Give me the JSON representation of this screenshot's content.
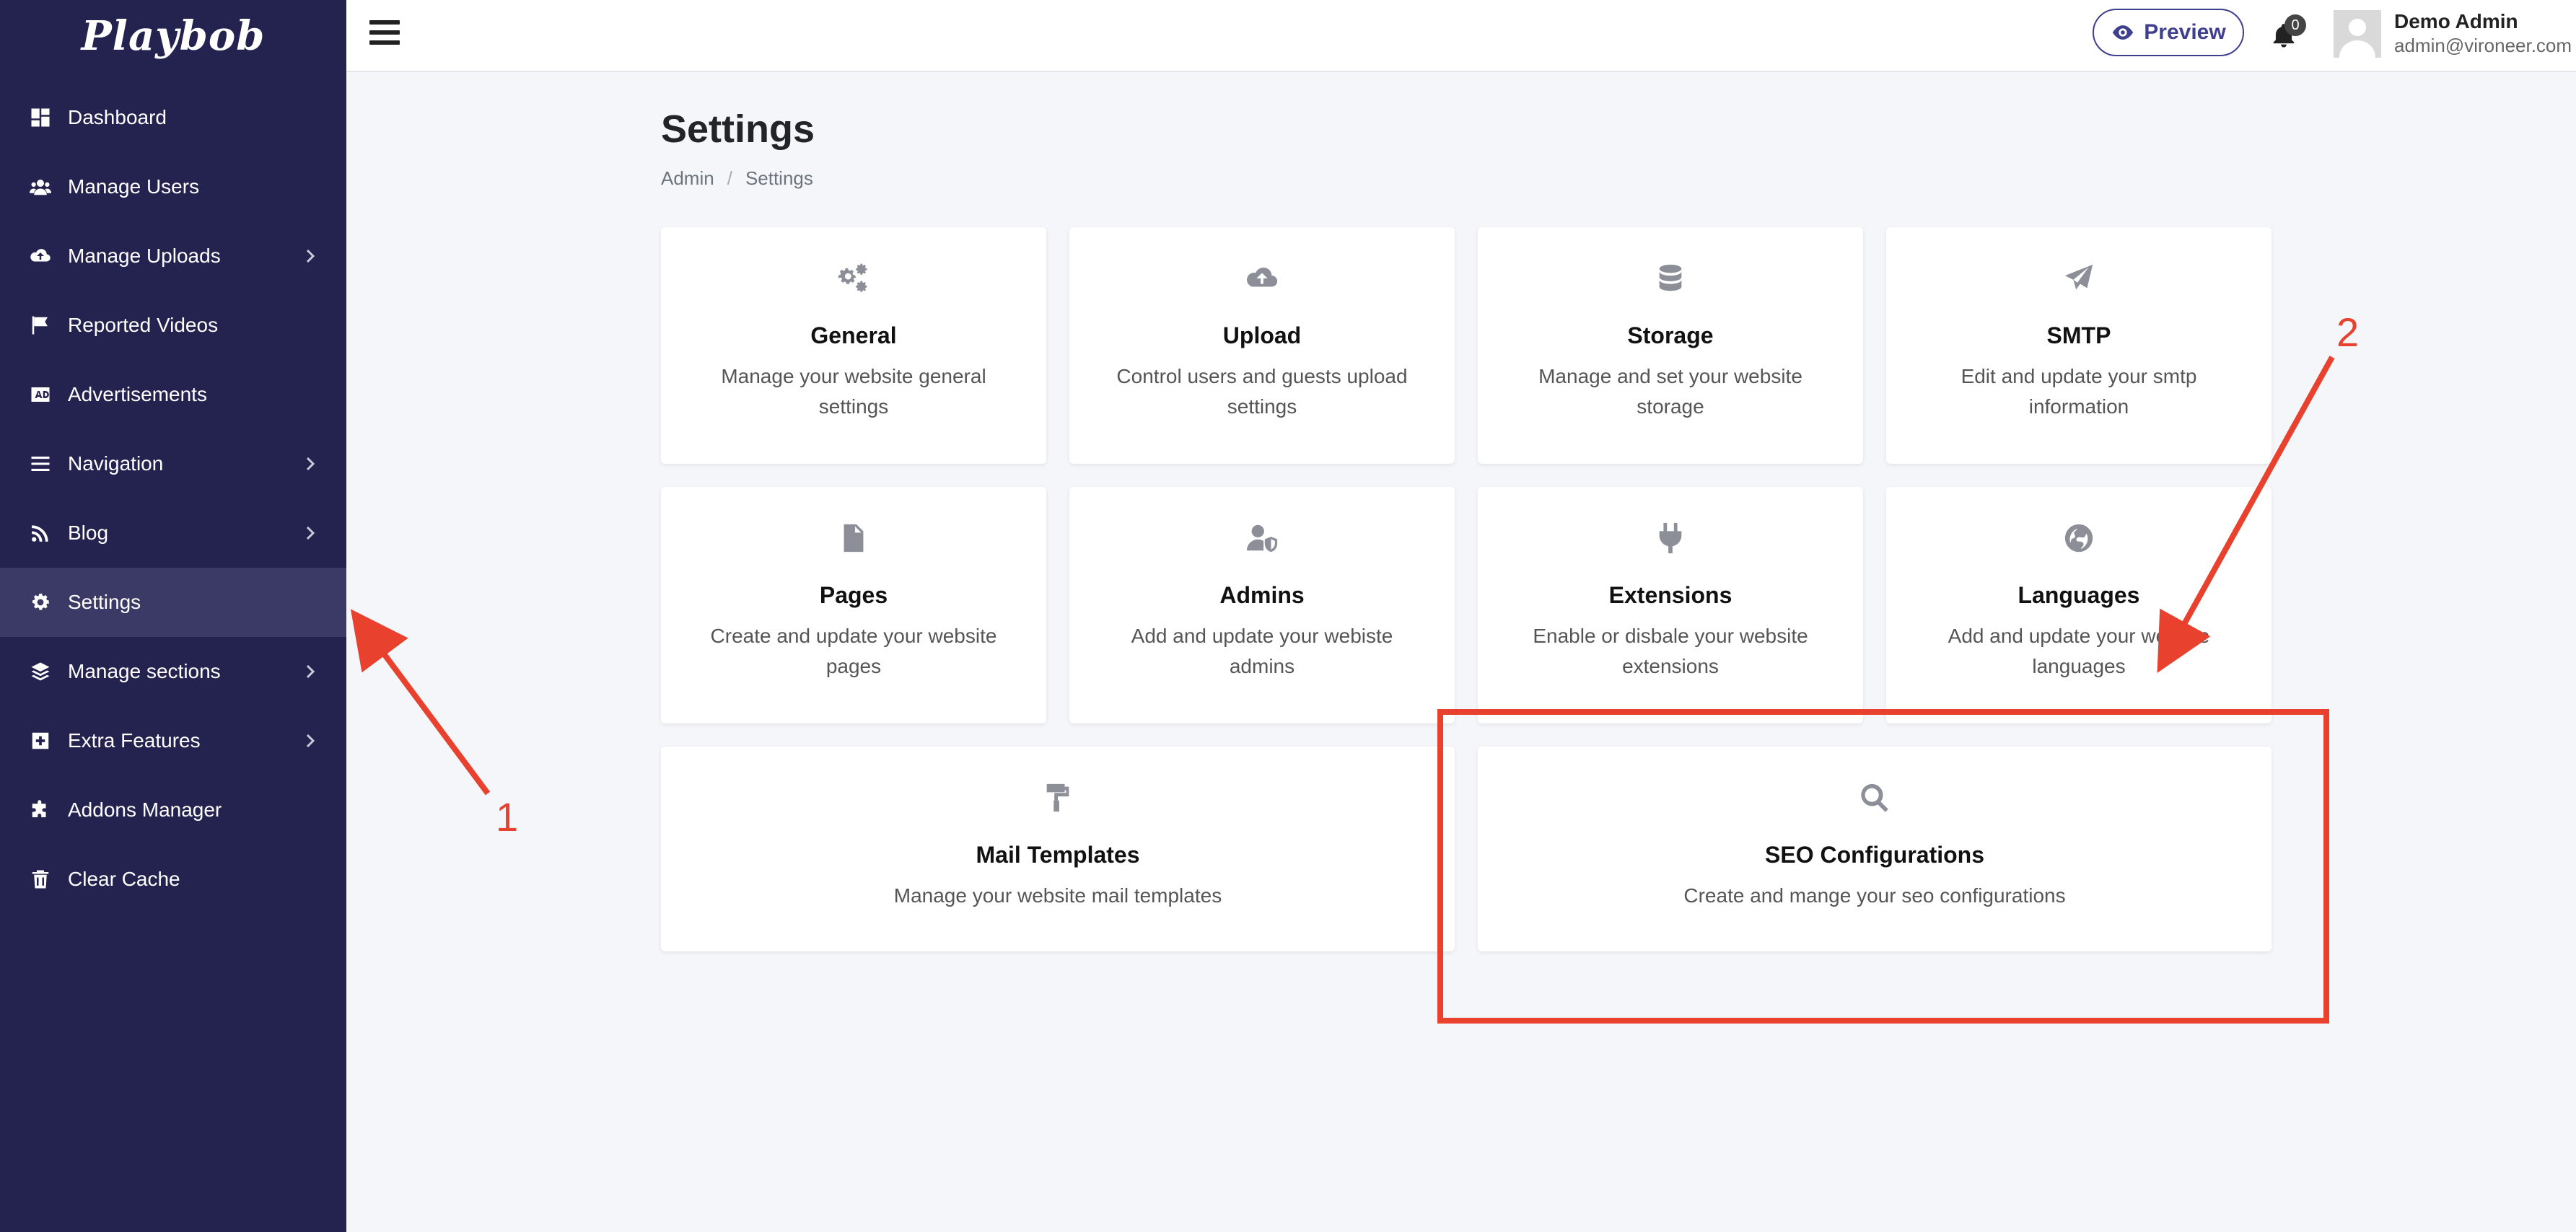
{
  "sidebar": {
    "logo": "Playbob",
    "items": [
      {
        "label": "Dashboard",
        "icon": "dashboard-icon"
      },
      {
        "label": "Manage Users",
        "icon": "users-icon"
      },
      {
        "label": "Manage Uploads",
        "icon": "cloud-upload-icon",
        "expandable": true
      },
      {
        "label": "Reported Videos",
        "icon": "flag-icon"
      },
      {
        "label": "Advertisements",
        "icon": "ad-icon"
      },
      {
        "label": "Navigation",
        "icon": "list-icon",
        "expandable": true
      },
      {
        "label": "Blog",
        "icon": "rss-icon",
        "expandable": true
      },
      {
        "label": "Settings",
        "icon": "gear-icon",
        "active": true
      },
      {
        "label": "Manage sections",
        "icon": "layers-icon",
        "expandable": true
      },
      {
        "label": "Extra Features",
        "icon": "plus-square-icon",
        "expandable": true
      },
      {
        "label": "Addons Manager",
        "icon": "puzzle-icon"
      },
      {
        "label": "Clear Cache",
        "icon": "trash-icon"
      }
    ]
  },
  "header": {
    "preview_label": "Preview",
    "notification_count": "0",
    "user_name": "Demo Admin",
    "user_email": "admin@vironeer.com"
  },
  "page": {
    "title": "Settings",
    "breadcrumb": [
      "Admin",
      "Settings"
    ]
  },
  "cards": [
    {
      "title": "General",
      "desc": "Manage your website general settings",
      "icon": "gears-icon"
    },
    {
      "title": "Upload",
      "desc": "Control users and guests upload settings",
      "icon": "cloud-upload-icon"
    },
    {
      "title": "Storage",
      "desc": "Manage and set your website storage",
      "icon": "database-icon"
    },
    {
      "title": "SMTP",
      "desc": "Edit and update your smtp information",
      "icon": "paper-plane-icon"
    },
    {
      "title": "Pages",
      "desc": "Create and update your website pages",
      "icon": "file-icon"
    },
    {
      "title": "Admins",
      "desc": "Add and update your webiste admins",
      "icon": "user-shield-icon"
    },
    {
      "title": "Extensions",
      "desc": "Enable or disbale your website extensions",
      "icon": "plug-icon"
    },
    {
      "title": "Languages",
      "desc": "Add and update your website languages",
      "icon": "globe-icon"
    },
    {
      "title": "Mail Templates",
      "desc": "Manage your website mail templates",
      "icon": "paint-roller-icon"
    },
    {
      "title": "SEO Configurations",
      "desc": "Create and mange your seo configurations",
      "icon": "search-icon"
    }
  ],
  "annotations": {
    "label_1": "1",
    "label_2": "2",
    "color": "#e8412e"
  },
  "colors": {
    "sidebar_bg": "#24234f",
    "sidebar_active": "#3b3a66",
    "accent": "#3f3f8f",
    "page_bg": "#f5f6fa"
  }
}
